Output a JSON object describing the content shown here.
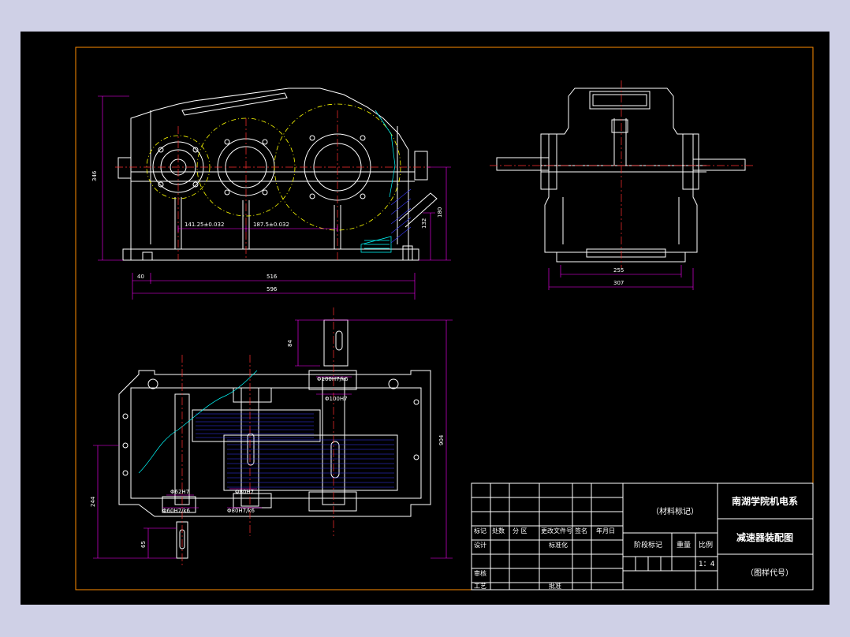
{
  "dimensions": {
    "front_height": "346",
    "center_dist_1": "141.25±0.032",
    "center_dist_2": "187.5±0.032",
    "front_right_180": "180",
    "front_right_132": "132",
    "front_bottom_40": "40",
    "front_bottom_516": "516",
    "front_bottom_596": "596",
    "side_255": "255",
    "side_307": "307",
    "plan_84": "84",
    "plan_904": "904",
    "plan_244": "244",
    "plan_65": "65",
    "fit_1": "Φ100H7/k6",
    "fit_2": "Φ100H7",
    "fit_3": "Φ62H7",
    "fit_4": "Φ60H7/k6",
    "fit_5": "Φ80H7",
    "fit_6": "Φ80H7/k6"
  },
  "title_block": {
    "material_mark": "（材料标记）",
    "school": "南湖学院机电系",
    "drawing_name": "减速器装配图",
    "drawing_code": "（图样代号）",
    "stage_mark": "阶段标记",
    "weight": "重量",
    "scale_label": "比例",
    "scale_value": "1：4",
    "row_mark": "标记",
    "row_count": "处数",
    "row_zone": "分 区",
    "row_doc": "更改文件号",
    "row_sign": "签名",
    "row_date": "年月日",
    "design": "设计",
    "standardize": "标准化",
    "review": "审核",
    "process": "工艺",
    "approve": "批准"
  },
  "colors": {
    "background": "#000000",
    "frame_border": "#ff8c00",
    "outline": "#ffffff",
    "centerline": "#ff3030",
    "dimension": "#ff00ff",
    "pitch_circle": "#ffff00",
    "hatch": "#3a3aff",
    "water": "#00ffff",
    "window": "#cfd0e6"
  }
}
